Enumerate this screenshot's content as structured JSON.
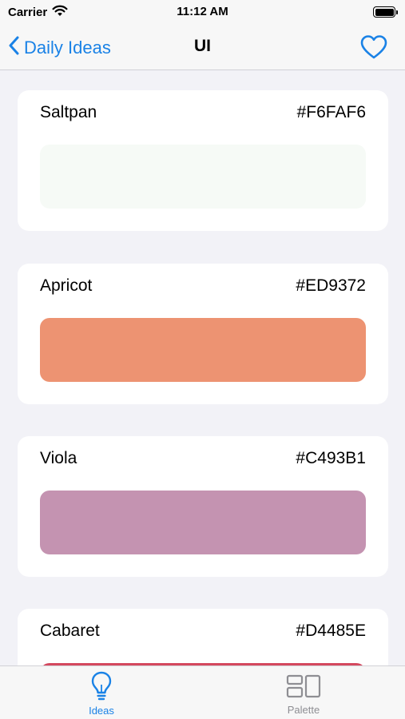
{
  "status_bar": {
    "carrier": "Carrier",
    "time": "11:12 AM",
    "icons": [
      "wifi-icon",
      "battery-icon"
    ]
  },
  "nav": {
    "back_label": "Daily Ideas",
    "title": "UI",
    "favorite_icon": "heart-outline-icon"
  },
  "colors": [
    {
      "name": "Saltpan",
      "hex": "#F6FAF6"
    },
    {
      "name": "Apricot",
      "hex": "#ED9372"
    },
    {
      "name": "Viola",
      "hex": "#C493B1"
    },
    {
      "name": "Cabaret",
      "hex": "#D4485E"
    }
  ],
  "tab_bar": {
    "tabs": [
      {
        "label": "Ideas",
        "icon": "lightbulb-icon",
        "selected": true
      },
      {
        "label": "Palette",
        "icon": "palette-grid-icon",
        "selected": false
      }
    ]
  },
  "theme": {
    "accent": "#1a82e6",
    "inactive": "#8e8e93",
    "background": "#f2f2f7",
    "card": "#ffffff"
  }
}
